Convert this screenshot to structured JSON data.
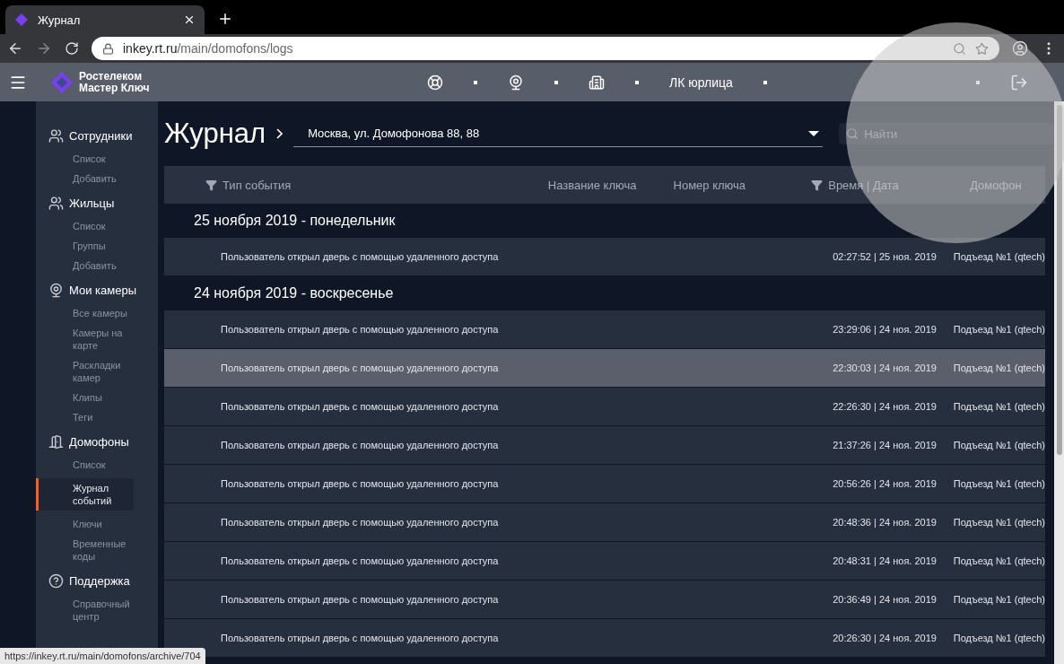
{
  "browser": {
    "tab_title": "Журнал",
    "url_host": "inkey.rt.ru",
    "url_path": "/main/domofons/logs",
    "status_url": "https://inkey.rt.ru/main/domofons/archive/704"
  },
  "header": {
    "logo_line1": "Ростелеком",
    "logo_line2": "Мастер Ключ",
    "account": "ЛК юрлица"
  },
  "sidebar": [
    {
      "kind": "people",
      "label": "Сотрудники",
      "children": [
        {
          "label": "Список",
          "selected": false
        },
        {
          "label": "Добавить",
          "selected": false
        }
      ]
    },
    {
      "kind": "people",
      "label": "Жильцы",
      "children": [
        {
          "label": "Список",
          "selected": false
        },
        {
          "label": "Группы",
          "selected": false
        },
        {
          "label": "Добавить",
          "selected": false
        }
      ]
    },
    {
      "kind": "camera",
      "label": "Мои камеры",
      "children": [
        {
          "label": "Все камеры",
          "selected": false
        },
        {
          "label": "Камеры на карте",
          "selected": false
        },
        {
          "label": "Раскладки камер",
          "selected": false
        },
        {
          "label": "Клипы",
          "selected": false
        },
        {
          "label": "Теги",
          "selected": false
        }
      ]
    },
    {
      "kind": "door",
      "label": "Домофоны",
      "children": [
        {
          "label": "Список",
          "selected": false
        },
        {
          "label": "Журнал событий",
          "selected": true
        },
        {
          "label": "Ключи",
          "selected": false
        },
        {
          "label": "Временные коды",
          "selected": false
        }
      ]
    },
    {
      "kind": "help",
      "label": "Поддержка",
      "children": [
        {
          "label": "Справочный центр",
          "selected": false
        }
      ]
    }
  ],
  "page": {
    "title": "Журнал",
    "address": "Москва, ул. Домофонова 88, 88",
    "search": {
      "placeholder": "Найти"
    }
  },
  "table": {
    "columns": [
      {
        "label": "Тип события",
        "filter": true
      },
      {
        "label": "Название ключа",
        "filter": false
      },
      {
        "label": "Номер ключа",
        "filter": false
      },
      {
        "label": "Время | Дата",
        "filter": true
      },
      {
        "label": "Домофон",
        "filter": false
      }
    ],
    "groups": [
      {
        "title": "25 ноября 2019 - понедельник",
        "rows": [
          {
            "event": "Пользователь открыл дверь с помощью удаленного доступа",
            "time": "02:27:52 | 25 ноя. 2019",
            "intercom": "Подъезд №1 (qtech)",
            "selected": false
          }
        ]
      },
      {
        "title": "24 ноября 2019 - воскресенье",
        "rows": [
          {
            "event": "Пользователь открыл дверь с помощью удаленного доступа",
            "time": "23:29:06 | 24 ноя. 2019",
            "intercom": "Подъезд №1 (qtech)",
            "selected": false
          },
          {
            "event": "Пользователь открыл дверь с помощью удаленного доступа",
            "time": "22:30:03 | 24 ноя. 2019",
            "intercom": "Подъезд №1 (qtech)",
            "selected": true
          },
          {
            "event": "Пользователь открыл дверь с помощью удаленного доступа",
            "time": "22:26:30 | 24 ноя. 2019",
            "intercom": "Подъезд №1 (qtech)",
            "selected": false
          },
          {
            "event": "Пользователь открыл дверь с помощью удаленного доступа",
            "time": "21:37:26 | 24 ноя. 2019",
            "intercom": "Подъезд №1 (qtech)",
            "selected": false
          },
          {
            "event": "Пользователь открыл дверь с помощью удаленного доступа",
            "time": "20:56:26 | 24 ноя. 2019",
            "intercom": "Подъезд №1 (qtech)",
            "selected": false
          },
          {
            "event": "Пользователь открыл дверь с помощью удаленного доступа",
            "time": "20:48:36 | 24 ноя. 2019",
            "intercom": "Подъезд №1 (qtech)",
            "selected": false
          },
          {
            "event": "Пользователь открыл дверь с помощью удаленного доступа",
            "time": "20:48:31 | 24 ноя. 2019",
            "intercom": "Подъезд №1 (qtech)",
            "selected": false
          },
          {
            "event": "Пользователь открыл дверь с помощью удаленного доступа",
            "time": "20:36:49 | 24 ноя. 2019",
            "intercom": "Подъезд №1 (qtech)",
            "selected": false
          },
          {
            "event": "Пользователь открыл дверь с помощью удаленного доступа",
            "time": "20:26:30 | 24 ноя. 2019",
            "intercom": "Подъезд №1 (qtech)",
            "selected": false
          }
        ]
      }
    ]
  }
}
